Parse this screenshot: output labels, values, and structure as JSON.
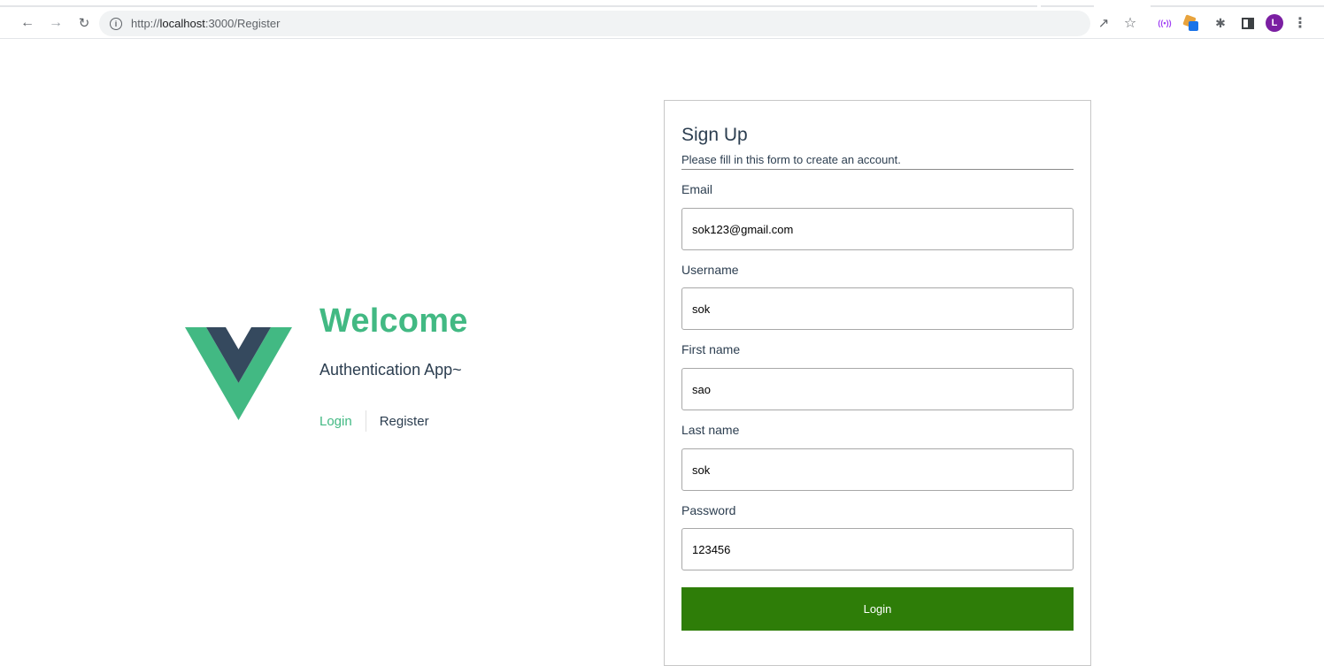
{
  "browser": {
    "url_prefix": "http://",
    "url_host": "localhost",
    "url_rest": ":3000/Register",
    "icons": {
      "back": "back-arrow-icon",
      "forward": "forward-arrow-icon",
      "reload": "reload-icon",
      "info": "info-icon",
      "share": "share-icon",
      "star": "star-icon",
      "cast": "cast-icon",
      "extension": "extension-icon",
      "puzzle": "puzzle-icon",
      "side_panel": "side-panel-icon",
      "menu": "kebab-menu-icon"
    },
    "avatar_letter": "L",
    "avatar_color": "#7b1fa2"
  },
  "hero": {
    "title": "Welcome",
    "subtitle": "Authentication App~",
    "nav": {
      "login": "Login",
      "register": "Register"
    },
    "logo_colors": {
      "outer": "#42b983",
      "inner": "#35495e"
    }
  },
  "form": {
    "title": "Sign Up",
    "description": "Please fill in this form to create an account.",
    "fields": {
      "email": {
        "label": "Email",
        "value": "sok123@gmail.com"
      },
      "username": {
        "label": "Username",
        "value": "sok"
      },
      "first_name": {
        "label": "First name",
        "value": "sao"
      },
      "last_name": {
        "label": "Last name",
        "value": "sok"
      },
      "password": {
        "label": "Password",
        "value": "123456"
      }
    },
    "submit_label": "Login",
    "submit_color": "#2e7d08"
  }
}
